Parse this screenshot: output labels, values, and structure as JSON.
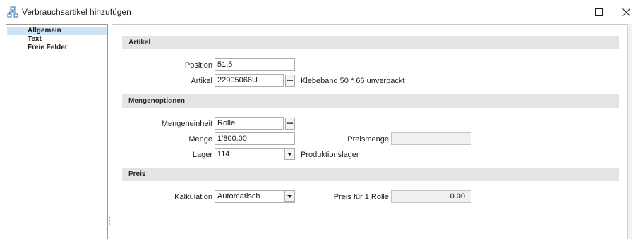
{
  "window": {
    "title": "Verbrauchsartikel hinzufügen",
    "icons": {
      "app": "hierarchy-icon",
      "maximize": "maximize-icon",
      "close": "close-icon"
    }
  },
  "nav": {
    "items": [
      {
        "label": "Allgemein",
        "selected": true
      },
      {
        "label": "Text",
        "selected": false
      },
      {
        "label": "Freie Felder",
        "selected": false
      }
    ],
    "selected_color": "#cfe3f8"
  },
  "sections": {
    "artikel": "Artikel",
    "mengenoptionen": "Mengenoptionen",
    "preis": "Preis"
  },
  "artikel": {
    "position_label": "Position",
    "position_value": "51.5",
    "artikel_label": "Artikel",
    "artikel_value": "22905066U",
    "browse_label": "...",
    "artikel_description": "Klebeband 50 * 66 unverpackt"
  },
  "mengenoptionen": {
    "mengeneinheit_label": "Mengeneinheit",
    "mengeneinheit_value": "Rolle",
    "browse_label": "...",
    "menge_label": "Menge",
    "menge_value": "1'800.00",
    "preismenge_label": "Preismenge",
    "preismenge_value": "",
    "lager_label": "Lager",
    "lager_value": "114",
    "lager_description": "Produktionslager"
  },
  "preis": {
    "kalkulation_label": "Kalkulation",
    "kalkulation_value": "Automatisch",
    "preis_label": "Preis für 1 Rolle",
    "preis_value": "0.00"
  },
  "colors": {
    "section_bg": "#e4e4e4",
    "readonly_bg": "#f0f0f0",
    "border": "#adadad"
  }
}
